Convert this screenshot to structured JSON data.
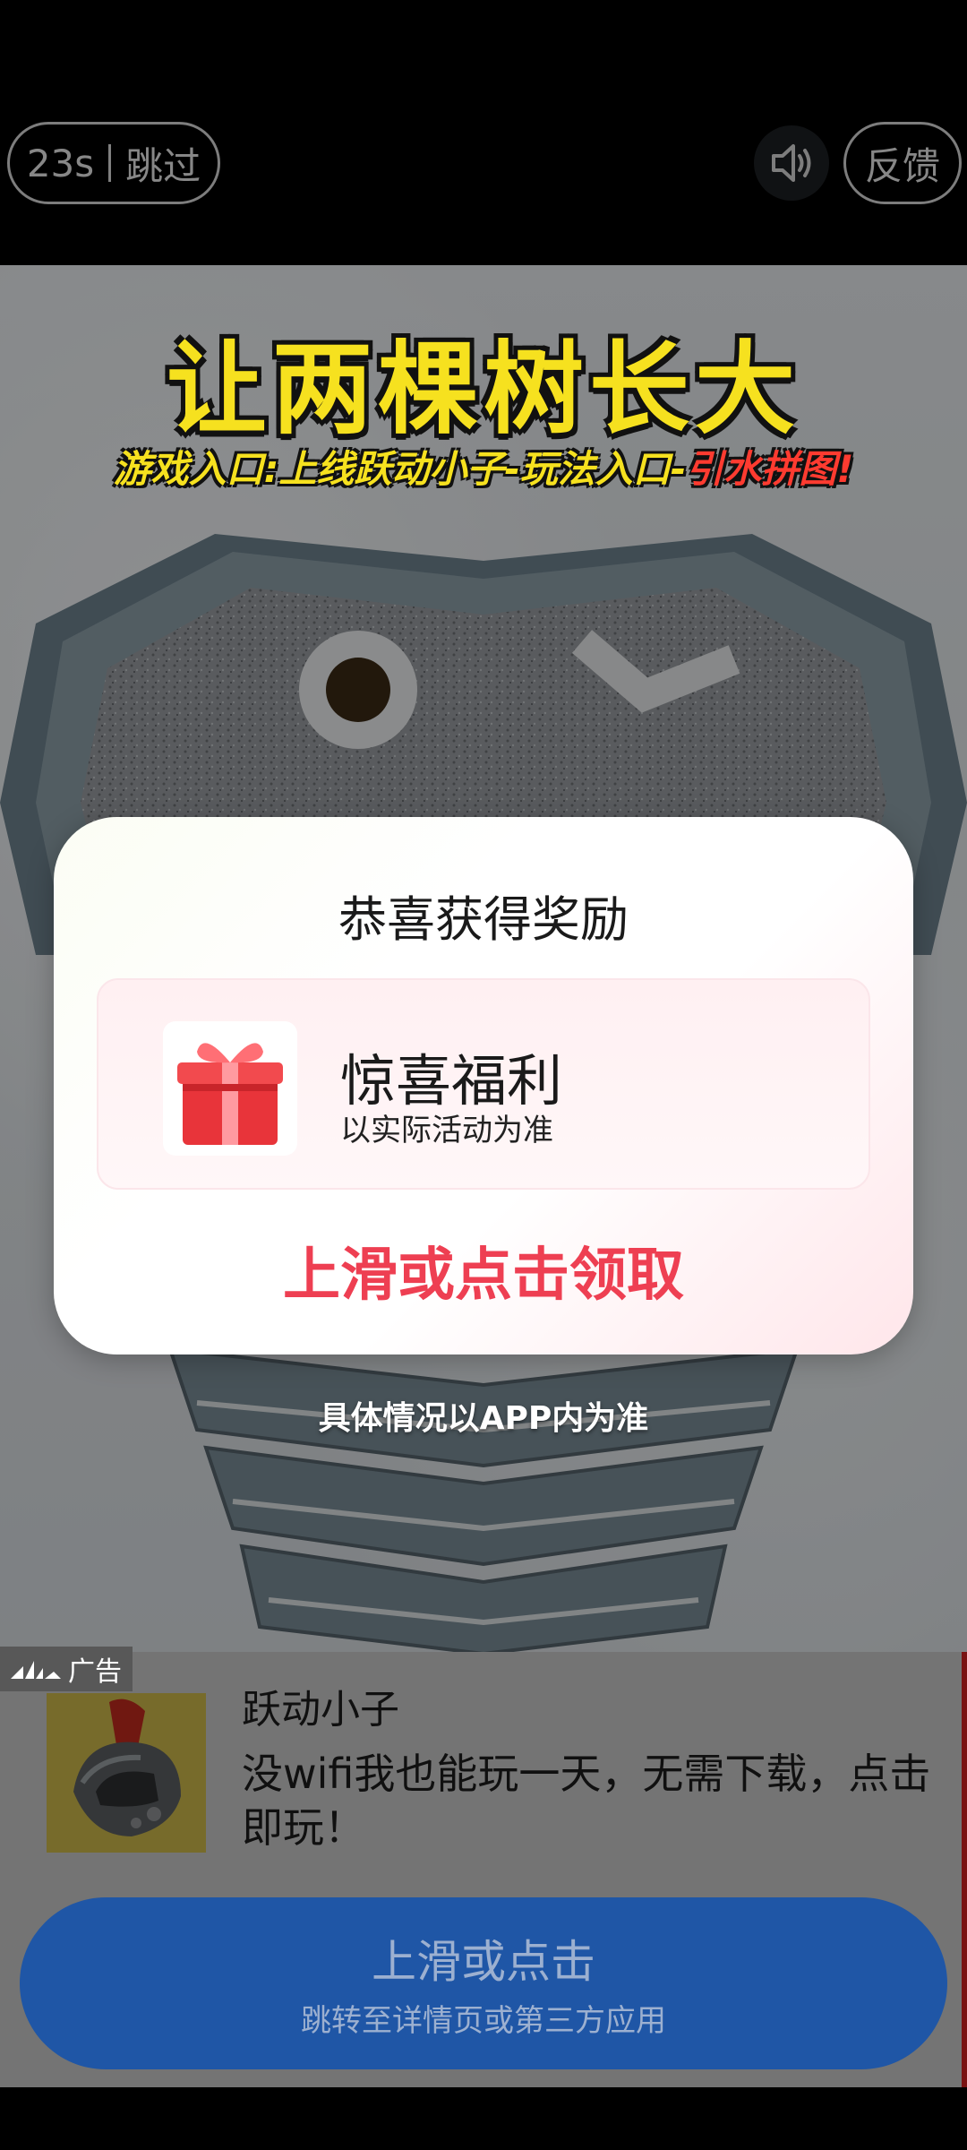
{
  "top": {
    "countdown": "23s",
    "skip_label": "跳过",
    "feedback_label": "反馈"
  },
  "game": {
    "title": "让两棵树长大",
    "subtitle_main": "游戏入口:上线跃动小子-玩法入口-",
    "subtitle_highlight": "引水拼图!"
  },
  "modal": {
    "title": "恭喜获得奖励",
    "reward_name": "惊喜福利",
    "reward_note": "以实际活动为准",
    "claim_label": "上滑或点击领取"
  },
  "app_note": "具体情况以APP内为准",
  "ad": {
    "tag_label": "广告",
    "app_name": "跃动小子",
    "description": "没wifi我也能玩一天，无需下载，点击即玩！",
    "cta_main": "上滑或点击",
    "cta_sub": "跳转至详情页或第三方应用"
  },
  "colors": {
    "claim": "#ee3f52",
    "cta_bg": "#1f56a6",
    "title_yellow": "#f6e11f"
  },
  "icons": [
    "volume-icon",
    "gift-icon",
    "signal-icon",
    "helmet-icon"
  ]
}
